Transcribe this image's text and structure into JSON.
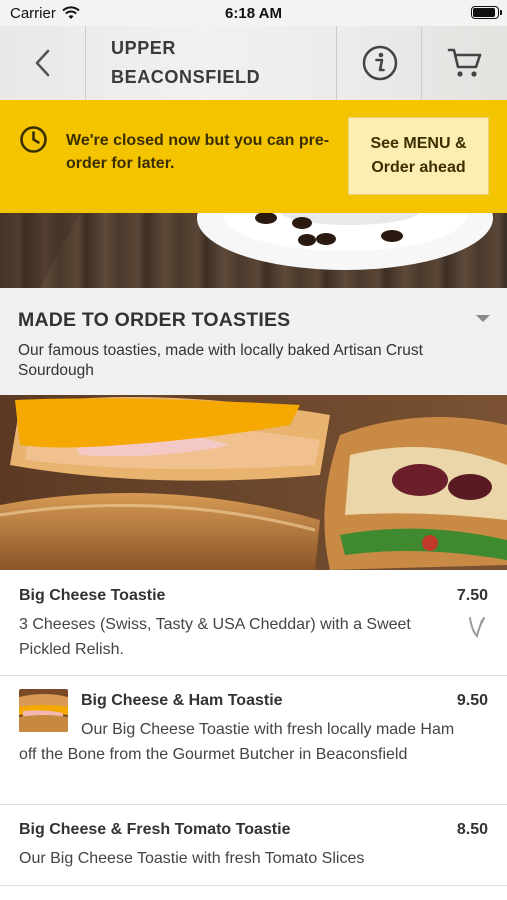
{
  "status_bar": {
    "carrier": "Carrier",
    "time": "6:18 AM"
  },
  "nav": {
    "title": "UPPER BEACONSFIELD",
    "back_icon": "chevron-left-icon",
    "info_icon": "info-icon",
    "cart_icon": "cart-icon"
  },
  "banner": {
    "message": "We're closed now but you can pre-order for later.",
    "button_label": "See MENU & Order ahead",
    "color": "#f5c400",
    "icon": "clock-icon"
  },
  "category": {
    "title": "MADE TO ORDER TOASTIES",
    "description": "Our famous toasties, made with locally baked Artisan Crust Sourdough"
  },
  "items": [
    {
      "name": "Big Cheese Toastie",
      "price": "7.50",
      "description": "3 Cheeses (Swiss, Tasty & USA Cheddar) with a Sweet Pickled Relish.",
      "badge_icon": "vegetarian-leaf-icon"
    },
    {
      "name": "Big Cheese & Ham Toastie",
      "price": "9.50",
      "description": "Our Big Cheese Toastie with fresh locally made Ham off the Bone from the Gourmet Butcher in Beaconsfield"
    },
    {
      "name": "Big Cheese & Fresh Tomato Toastie",
      "price": "8.50",
      "description": "Our Big Cheese Toastie with fresh Tomato Slices"
    }
  ]
}
